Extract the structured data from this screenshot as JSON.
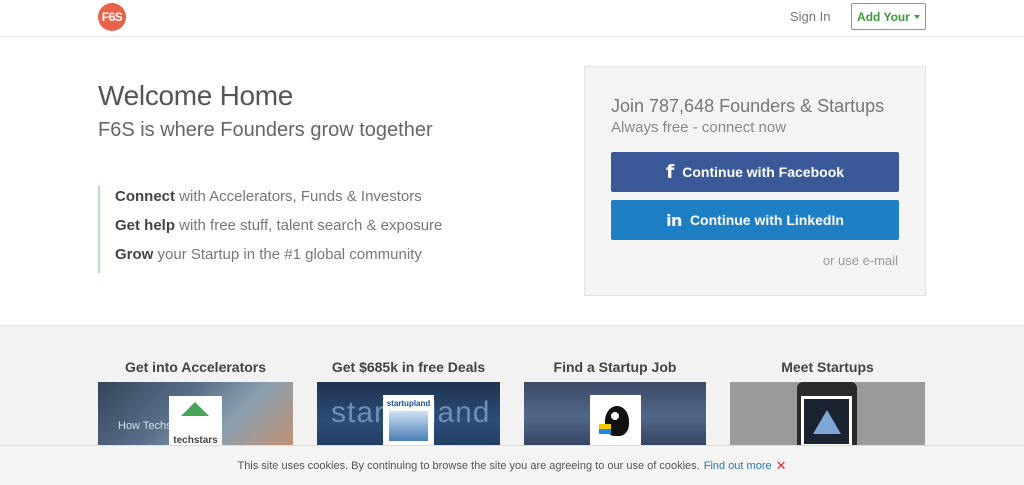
{
  "header": {
    "logo_text": "F6S",
    "sign_in": "Sign In",
    "add_your": "Add Your"
  },
  "hero": {
    "title": "Welcome Home",
    "tagline": "F6S is where Founders grow together",
    "benefits": [
      {
        "bold": "Connect",
        "rest": " with Accelerators, Funds & Investors"
      },
      {
        "bold": "Get help",
        "rest": " with free stuff, talent search & exposure"
      },
      {
        "bold": "Grow",
        "rest": " your Startup in the #1 global community"
      }
    ]
  },
  "signup": {
    "join": "Join 787,648 Founders & Startups",
    "free": "Always free - connect now",
    "facebook_label": "Continue with Facebook",
    "facebook_glyph": "f",
    "linkedin_label": "Continue with LinkedIn",
    "linkedin_glyph": "in",
    "email_link": "or use e-mail"
  },
  "features": [
    {
      "title": "Get into Accelerators",
      "badge_text": "techstars",
      "overlay_text": "How Techstars"
    },
    {
      "title": "Get $685k in free Deals",
      "badge_text": "startupland",
      "overlay_text": "startupland"
    },
    {
      "title": "Find a Startup Job"
    },
    {
      "title": "Meet Startups"
    }
  ],
  "cookie": {
    "message": "This site uses cookies. By continuing to browse the site you are agreeing to our use of cookies.",
    "find_out": "Find out more",
    "close": "✕"
  },
  "colors": {
    "logo": "#e8624a",
    "facebook": "#3b5998",
    "linkedin": "#1e7fc4",
    "accent_green": "#5cb85c",
    "link_blue": "#2a7ab8"
  }
}
